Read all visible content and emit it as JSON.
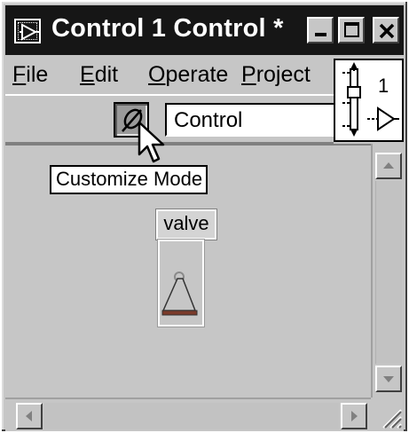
{
  "window": {
    "title": "Control 1 Control *"
  },
  "menu": {
    "items": [
      {
        "label": "File",
        "mnemonic": "F",
        "rest": "ile"
      },
      {
        "label": "Edit",
        "mnemonic": "E",
        "rest": "dit"
      },
      {
        "label": "Operate",
        "mnemonic": "O",
        "rest": "perate"
      },
      {
        "label": "Project",
        "mnemonic": "P",
        "rest": "roject"
      }
    ]
  },
  "toolbar": {
    "customize_icon": "pencil-wrench-icon",
    "edit_mode_value": "Control"
  },
  "tooltip": {
    "text": "Customize Mode"
  },
  "connector_pane": {
    "label": "1"
  },
  "control": {
    "label": "valve",
    "icon": "valve-icon"
  },
  "colors": {
    "title_bar": "#161616",
    "face": "#c6c6c6",
    "valve_base": "#7a3a2a"
  }
}
